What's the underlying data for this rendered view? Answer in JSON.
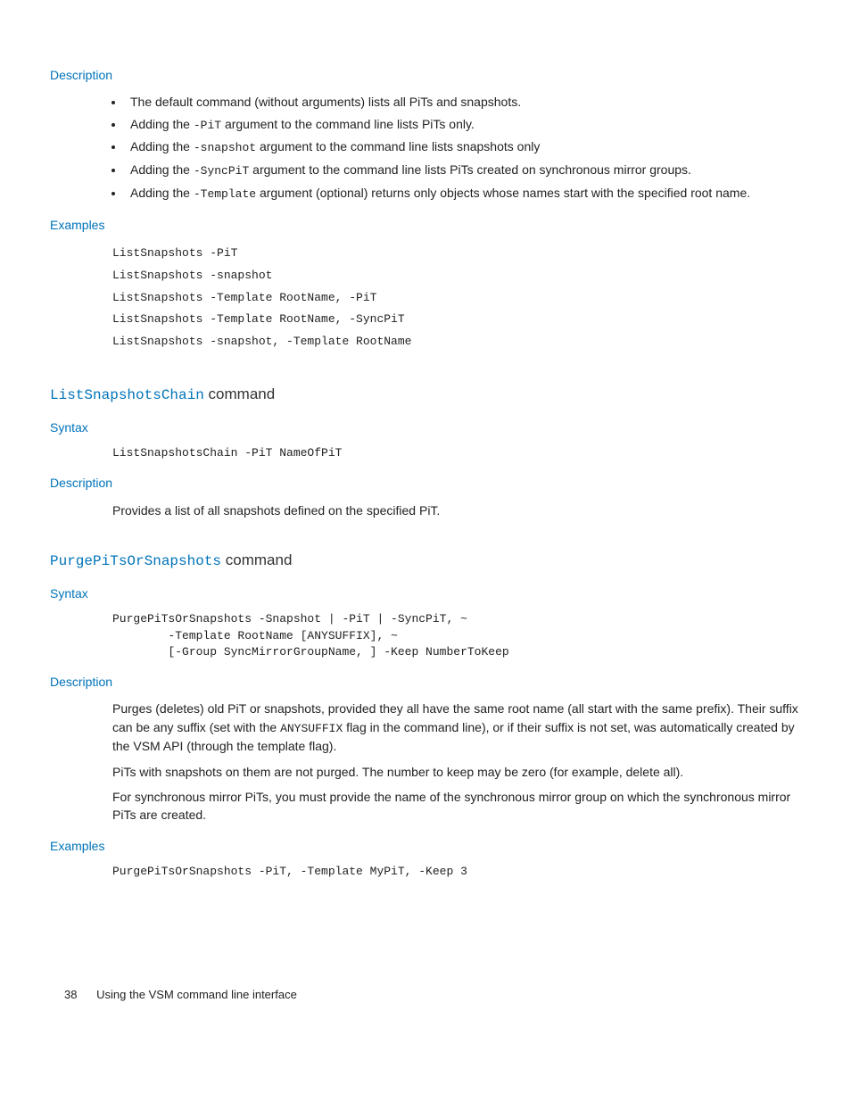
{
  "s1": {
    "desc_head": "Description",
    "bullets": {
      "b0": "The default command (without arguments) lists all PiTs and snapshots.",
      "b1a": "Adding the ",
      "b1code": "-PiT",
      "b1b": " argument to the command line lists PiTs only.",
      "b2a": "Adding the ",
      "b2code": "-snapshot",
      "b2b": " argument to the command line lists snapshots only",
      "b3a": "Adding the ",
      "b3code": "-SyncPiT",
      "b3b": " argument to the command line lists PiTs created on synchronous mirror groups.",
      "b4a": "Adding the ",
      "b4code": "-Template",
      "b4b": " argument (optional) returns only objects whose names start with the specified root name."
    },
    "ex_head": "Examples",
    "ex_code": "ListSnapshots -PiT\nListSnapshots -snapshot\nListSnapshots -Template RootName, -PiT\nListSnapshots -Template RootName, -SyncPiT\nListSnapshots -snapshot, -Template RootName"
  },
  "s2": {
    "title_code": "ListSnapshotsChain",
    "title_word": " command",
    "syn_head": "Syntax",
    "syn_code": "ListSnapshotsChain -PiT NameOfPiT",
    "desc_head": "Description",
    "desc_body": "Provides a list of all snapshots defined on the specified PiT."
  },
  "s3": {
    "title_code": "PurgePiTsOrSnapshots",
    "title_word": " command",
    "syn_head": "Syntax",
    "syn_code": "PurgePiTsOrSnapshots -Snapshot | -PiT | -SyncPiT, ~\n        -Template RootName [ANYSUFFIX], ~\n        [-Group SyncMirrorGroupName, ] -Keep NumberToKeep",
    "desc_head": "Description",
    "p1a": "Purges (deletes) old PiT or snapshots, provided they all have the same root name (all start with the same prefix). Their suffix can be any suffix (set with the ",
    "p1code": "ANYSUFFIX",
    "p1b": " flag in the command line), or if their suffix is not set, was automatically created by the VSM API (through the template flag).",
    "p2": "PiTs with snapshots on them are not purged. The number to keep may be zero (for example, delete all).",
    "p3": "For synchronous mirror PiTs, you must provide the name of the synchronous mirror group on which the synchronous mirror PiTs are created.",
    "ex_head": "Examples",
    "ex_code": "PurgePiTsOrSnapshots -PiT, -Template MyPiT, -Keep 3"
  },
  "footer": {
    "page": "38",
    "text": "Using the VSM command line interface"
  }
}
